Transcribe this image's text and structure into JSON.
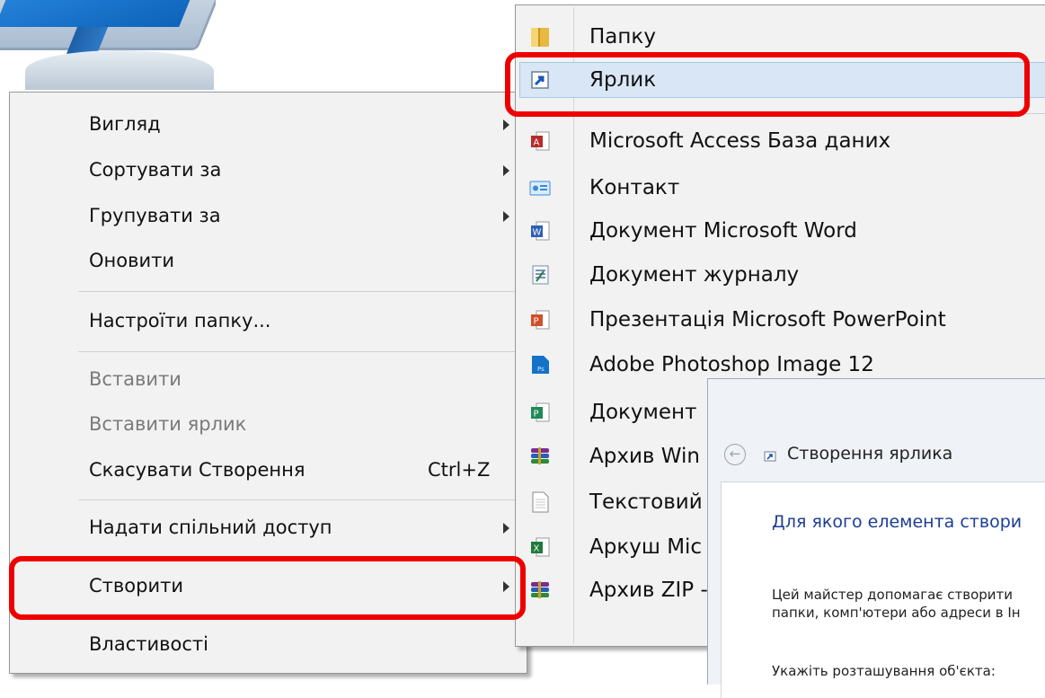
{
  "context_menu": {
    "items": [
      {
        "label": "Вигляд",
        "submenu": true
      },
      {
        "label": "Сортувати за",
        "submenu": true
      },
      {
        "label": "Групувати за",
        "submenu": true
      },
      {
        "label": "Оновити"
      },
      {
        "label": "Настроїти папку..."
      },
      {
        "label": "Вставити",
        "disabled": true
      },
      {
        "label": "Вставити ярлик",
        "disabled": true
      },
      {
        "label": "Скасувати Створення",
        "shortcut": "Ctrl+Z"
      },
      {
        "label": "Надати спільний доступ",
        "submenu": true
      },
      {
        "label": "Створити",
        "submenu": true,
        "annotated": true
      },
      {
        "label": "Властивості"
      }
    ]
  },
  "new_submenu": {
    "items": [
      {
        "label": "Папку",
        "icon": "folder-icon"
      },
      {
        "label": "Ярлик",
        "icon": "shortcut-icon",
        "highlighted": true
      },
      {
        "label": "Microsoft Access База даних",
        "icon": "access-icon"
      },
      {
        "label": "Контакт",
        "icon": "contact-icon"
      },
      {
        "label": "Документ Microsoft Word",
        "icon": "word-icon"
      },
      {
        "label": "Документ журналу",
        "icon": "journal-icon"
      },
      {
        "label": "Презентація Microsoft PowerPoint",
        "icon": "powerpoint-icon"
      },
      {
        "label": "Adobe Photoshop Image 12",
        "icon": "photoshop-icon"
      },
      {
        "label": "Документ",
        "icon": "publisher-icon"
      },
      {
        "label": "Архив Win",
        "icon": "winrar-icon"
      },
      {
        "label": "Текстовий",
        "icon": "text-file-icon"
      },
      {
        "label": "Аркуш Mic",
        "icon": "excel-icon"
      },
      {
        "label": "Архив ZIP -",
        "icon": "zip-archive-icon"
      }
    ]
  },
  "wizard": {
    "title": "Створення ярлика",
    "heading": "Для якого елемента створи",
    "text_line1": "Цей майстер допомагає створити",
    "text_line2": "папки, комп'ютери або адреси в Ін",
    "text_line3": "Укажіть розташування об'єкта:"
  },
  "colors": {
    "annotation_red": "#ee0000",
    "menu_background": "#f2f2f2",
    "highlight_blue": "#d9e6f5",
    "wizard_heading_blue": "#1c3d98"
  }
}
